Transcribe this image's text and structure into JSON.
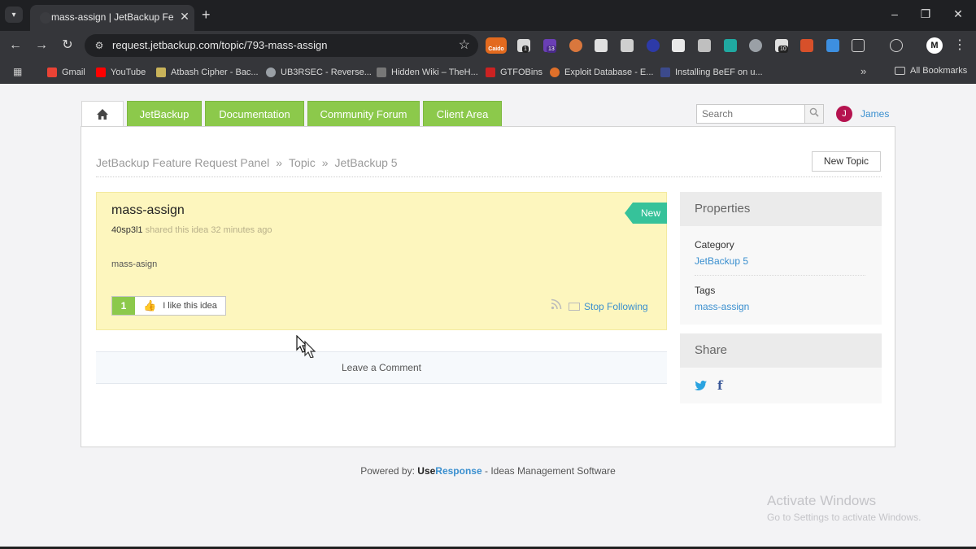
{
  "browser": {
    "tab_title": "mass-assign | JetBackup Featu",
    "url": "request.jetbackup.com/topic/793-mass-assign",
    "profile_initial": "M",
    "extensions": {
      "caido_label": "Caido",
      "badge_1": "1",
      "badge_13": "13",
      "badge_10": "10"
    },
    "bookmarks": [
      {
        "label": "Gmail",
        "color": "#ea4335"
      },
      {
        "label": "YouTube",
        "color": "#ff0000"
      },
      {
        "label": "Atbash Cipher - Bac...",
        "color": "#c9b35a"
      },
      {
        "label": "UB3RSEC - Reverse...",
        "color": "#9aa0a6"
      },
      {
        "label": "Hidden Wiki – TheH...",
        "color": "#777777"
      },
      {
        "label": "GTFOBins",
        "color": "#cc2222"
      },
      {
        "label": "Exploit Database - E...",
        "color": "#e0702a"
      },
      {
        "label": "Installing BeEF on u...",
        "color": "#3c4a8c"
      }
    ],
    "all_bookmarks": "All Bookmarks"
  },
  "nav": {
    "tabs": [
      "JetBackup",
      "Documentation",
      "Community Forum",
      "Client Area"
    ]
  },
  "search": {
    "placeholder": "Search"
  },
  "user": {
    "initial": "J",
    "name": "James"
  },
  "breadcrumb": [
    "JetBackup Feature Request Panel",
    "Topic",
    "JetBackup 5"
  ],
  "breadcrumb_sep": "»",
  "new_topic_label": "New Topic",
  "idea": {
    "title": "mass-assign",
    "author": "40sp3l1",
    "meta": "shared this idea 32 minutes ago",
    "status": "New",
    "body": "mass-asign",
    "votes": "1",
    "like_label": "I like this idea",
    "follow_label": "Stop Following"
  },
  "comment_label": "Leave a Comment",
  "properties": {
    "heading": "Properties",
    "category_label": "Category",
    "category_value": "JetBackup 5",
    "tags_label": "Tags",
    "tags_value": "mass-assign"
  },
  "share": {
    "heading": "Share"
  },
  "footer": {
    "prefix": "Powered by: ",
    "brand_use": "Use",
    "brand_response": "Response",
    "suffix": " - Ideas Management Software"
  },
  "activate": {
    "title": "Activate Windows",
    "subtitle": "Go to Settings to activate Windows."
  },
  "colors": {
    "accent_green": "#8cc94b",
    "status_new": "#36c29a",
    "link_blue": "#3a8fcf",
    "idea_bg": "#fdf6be"
  }
}
